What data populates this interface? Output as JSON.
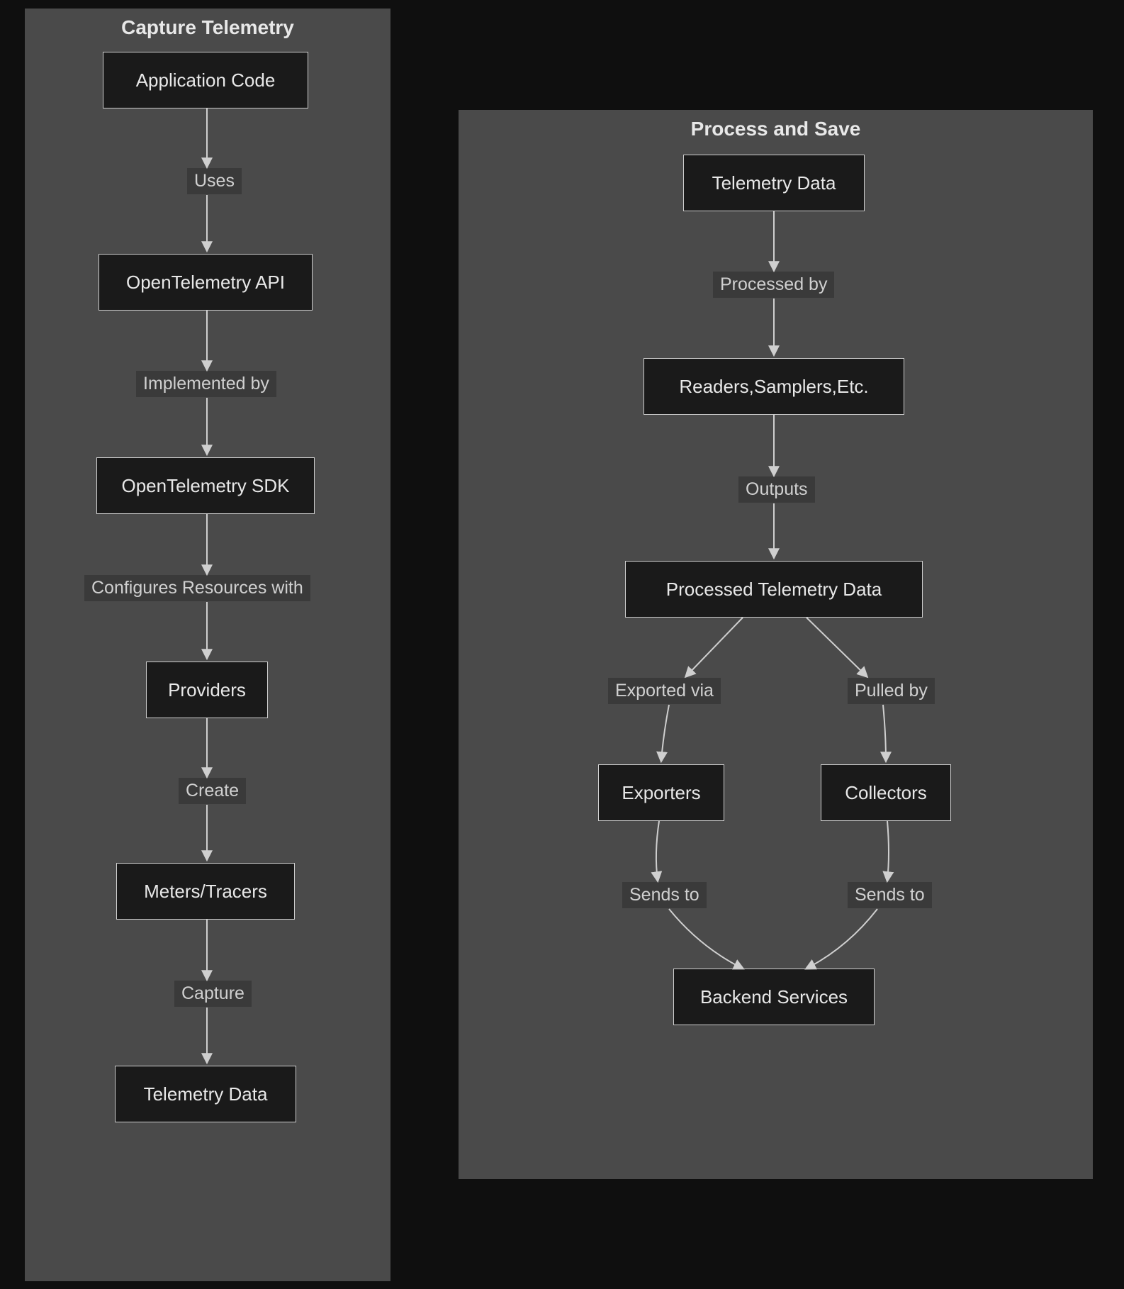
{
  "panels": {
    "capture": {
      "title": "Capture Telemetry",
      "nodes": {
        "app_code": "Application Code",
        "otel_api": "OpenTelemetry API",
        "otel_sdk": "OpenTelemetry SDK",
        "providers": "Providers",
        "meters_tracers": "Meters/Tracers",
        "telemetry_data": "Telemetry Data"
      },
      "edges": {
        "uses": "Uses",
        "implemented_by": "Implemented by",
        "configures_resources": "Configures Resources with",
        "create": "Create",
        "capture": "Capture"
      }
    },
    "process": {
      "title": "Process and Save",
      "nodes": {
        "telemetry_data": "Telemetry Data",
        "readers_samplers": "Readers,Samplers,Etc.",
        "processed_data": "Processed Telemetry Data",
        "exporters": "Exporters",
        "collectors": "Collectors",
        "backend_services": "Backend Services"
      },
      "edges": {
        "processed_by": "Processed by",
        "outputs": "Outputs",
        "exported_via": "Exported via",
        "pulled_by": "Pulled by",
        "sends_to_1": "Sends to",
        "sends_to_2": "Sends to"
      }
    }
  }
}
